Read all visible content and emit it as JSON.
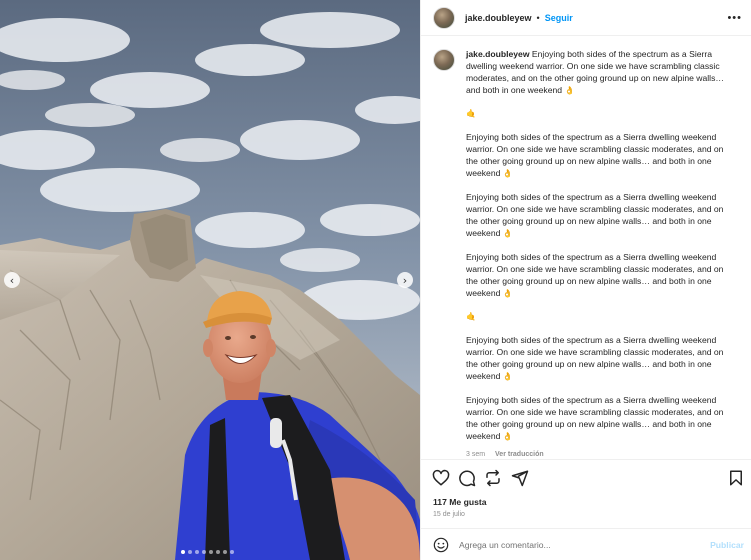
{
  "post": {
    "username": "jake.doubleyew",
    "follow_separator": "•",
    "follow_label": "Seguir",
    "more_label": "•••"
  },
  "media": {
    "prev_icon": "‹",
    "next_icon": "›",
    "carousel_count": 8,
    "carousel_active_index": 0
  },
  "caption": {
    "username": "jake.doubleyew",
    "first_text": "Enjoying both sides of the spectrum as a Sierra dwelling weekend warrior. On one side we have scrambling classic moderates, and on the other going ground up on new alpine walls… and both in one weekend",
    "paragraphs": [
      "👌",
      "🤙",
      "Enjoying both sides of the spectrum as a Sierra dwelling weekend warrior. On one side we have scrambling classic moderates, and on the other going ground up on new alpine walls… and both in one weekend",
      "👌",
      "Enjoying both sides of the spectrum as a Sierra dwelling weekend warrior. On one side we have scrambling classic moderates, and on the other going ground up on new alpine walls… and both in one weekend",
      "👌",
      "Enjoying both sides of the spectrum as a Sierra dwelling weekend warrior. On one side we have scrambling classic moderates, and on the other going ground up on new alpine walls… and both in one weekend",
      "👌",
      "🤙",
      "Enjoying both sides of the spectrum as a Sierra dwelling weekend warrior. On one side we have scrambling classic moderates, and on the other going ground up on new alpine walls… and both in one weekend",
      "👌",
      "Enjoying both sides of the spectrum as a Sierra dwelling weekend warrior. On one side we have scrambling classic moderates, and on the other going ground up on new alpine walls… and both in one weekend",
      "👌"
    ],
    "time_ago": "3 sem",
    "translate_label": "Ver traducción"
  },
  "actions": {
    "likes": "117 Me gusta",
    "date": "15 de julio"
  },
  "composer": {
    "placeholder": "Agrega un comentario...",
    "publish_label": "Publicar"
  },
  "colors": {
    "accent": "#0095f6",
    "publish_disabled": "#b2dffc",
    "muted": "#8e8e8e",
    "shirt": "#2f3fd0",
    "hat": "#e8a24a"
  }
}
